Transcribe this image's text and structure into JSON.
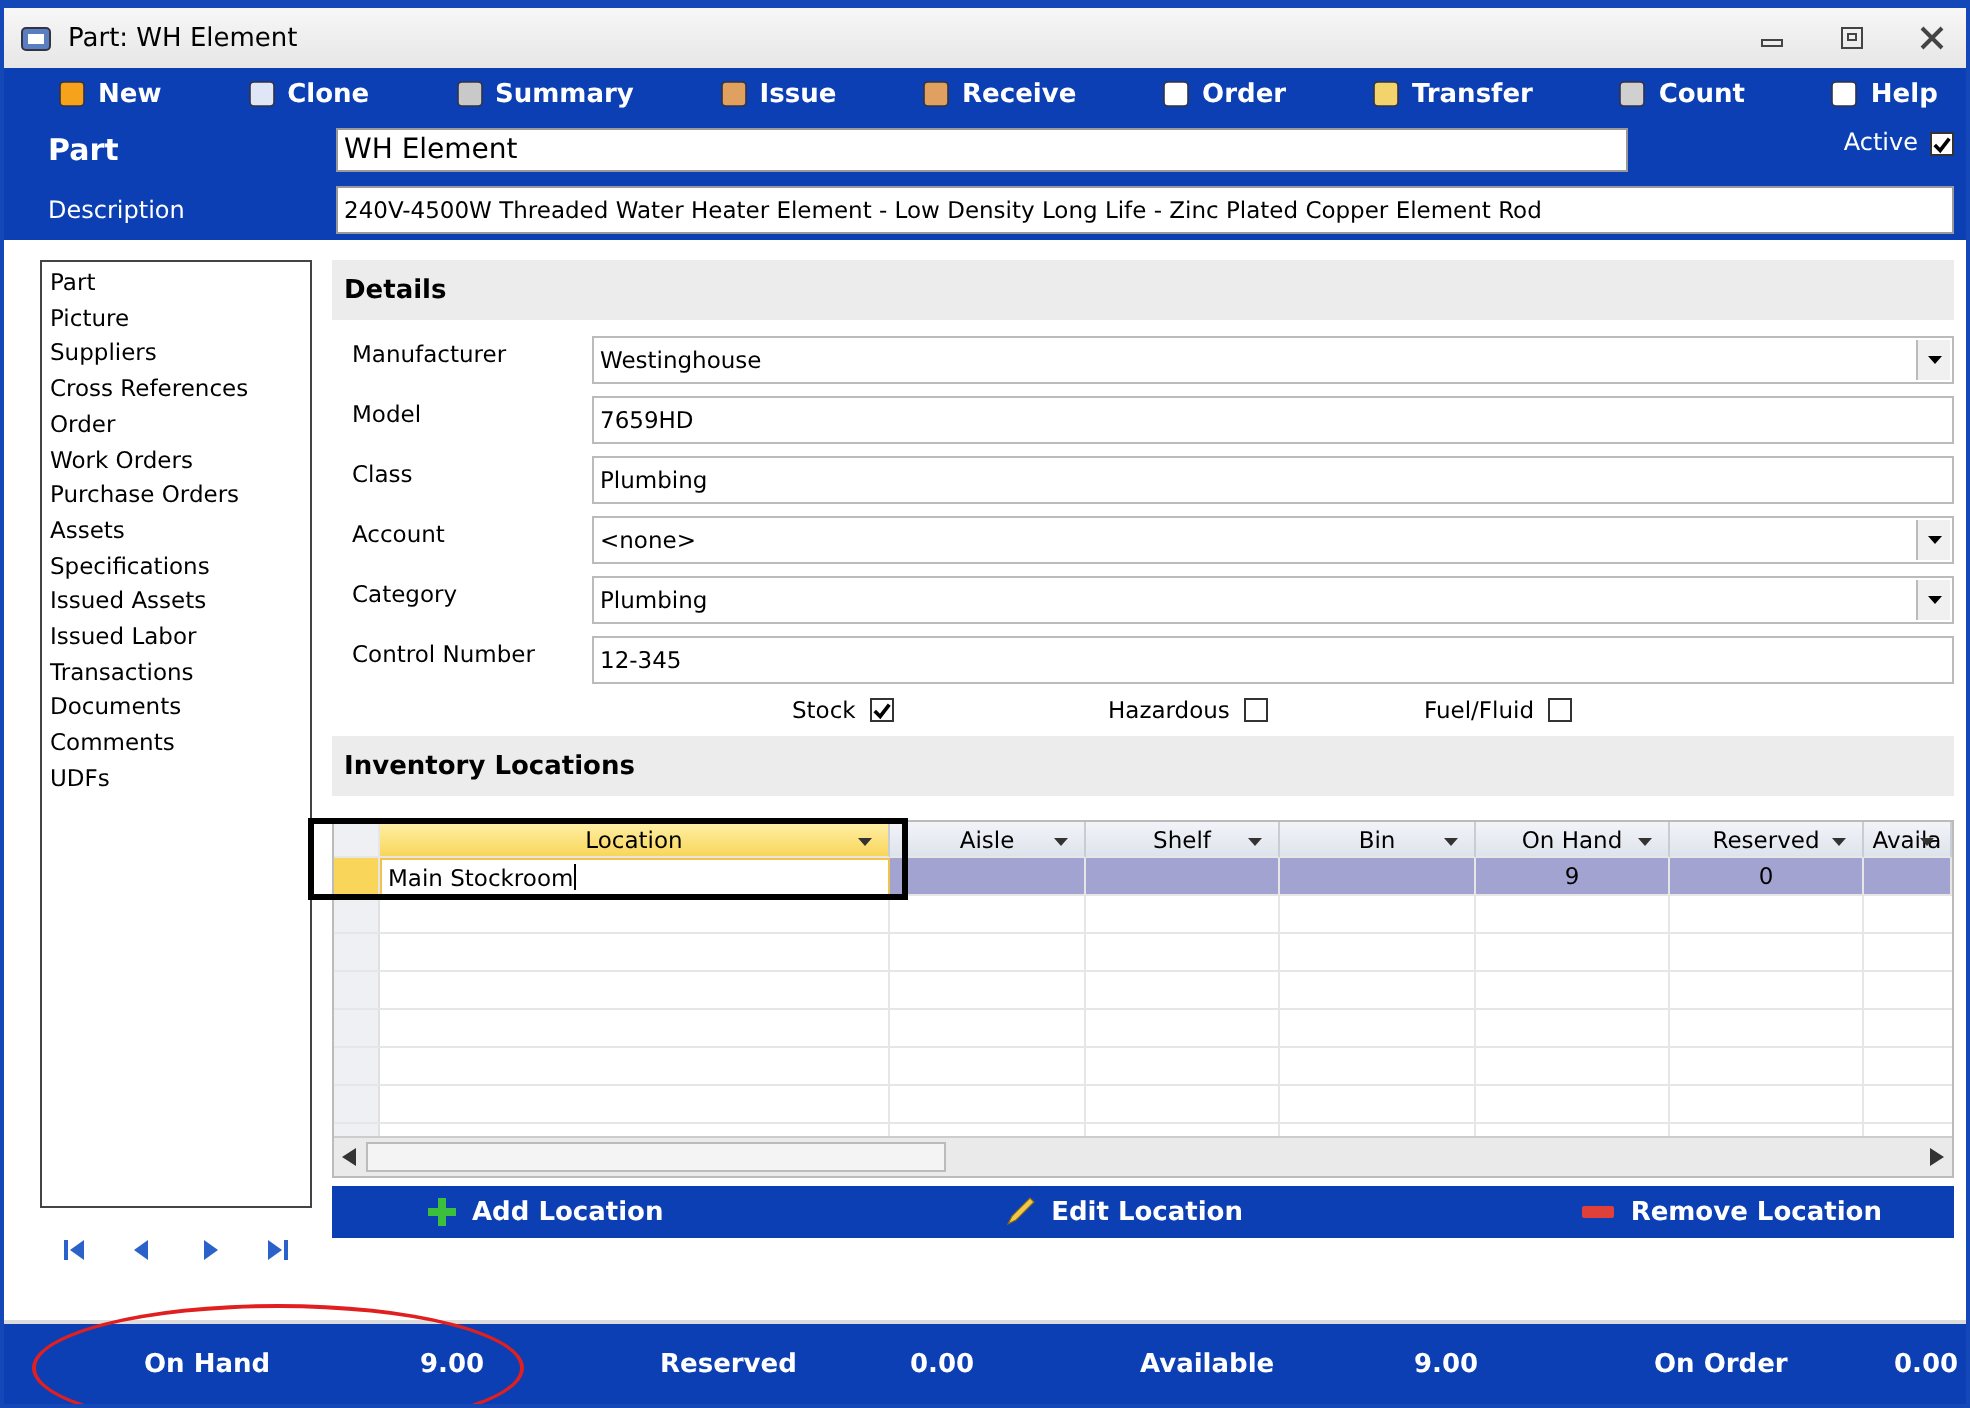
{
  "window": {
    "title": "Part:  WH Element"
  },
  "toolbar": [
    {
      "label": "New"
    },
    {
      "label": "Clone"
    },
    {
      "label": "Summary"
    },
    {
      "label": "Issue"
    },
    {
      "label": "Receive"
    },
    {
      "label": "Order"
    },
    {
      "label": "Transfer"
    },
    {
      "label": "Count"
    },
    {
      "label": "Help"
    }
  ],
  "part": {
    "label": "Part",
    "value": "WH Element",
    "active_label": "Active",
    "active": true
  },
  "description": {
    "label": "Description",
    "value": "240V-4500W Threaded Water Heater Element - Low Density Long Life - Zinc Plated Copper Element Rod"
  },
  "sidebar": {
    "items": [
      "Part",
      "Picture",
      "Suppliers",
      "Cross References",
      "Order",
      "Work Orders",
      "Purchase Orders",
      "Assets",
      "Specifications",
      "Issued Assets",
      "Issued Labor",
      "Transactions",
      "Documents",
      "Comments",
      "UDFs"
    ]
  },
  "details": {
    "title": "Details",
    "fields": [
      {
        "label": "Manufacturer",
        "value": "Westinghouse",
        "kind": "dropdown"
      },
      {
        "label": "Model",
        "value": "7659HD",
        "kind": "text"
      },
      {
        "label": "Class",
        "value": "Plumbing",
        "kind": "text"
      },
      {
        "label": "Account",
        "value": "<none>",
        "kind": "dropdown"
      },
      {
        "label": "Category",
        "value": "Plumbing",
        "kind": "dropdown"
      },
      {
        "label": "Control Number",
        "value": "12-345",
        "kind": "text"
      }
    ],
    "checkboxes": [
      {
        "label": "Stock",
        "checked": true
      },
      {
        "label": "Hazardous",
        "checked": false
      },
      {
        "label": "Fuel/Fluid",
        "checked": false
      }
    ]
  },
  "inventory": {
    "title": "Inventory Locations",
    "columns": [
      "Location",
      "Aisle",
      "Shelf",
      "Bin",
      "On Hand",
      "Reserved",
      "Availa"
    ],
    "rows": [
      {
        "selected": true,
        "cells": [
          "Main Stockroom",
          null,
          null,
          null,
          "9",
          "0",
          null
        ]
      }
    ]
  },
  "actions": [
    {
      "label": "Add Location",
      "kind": "add"
    },
    {
      "label": "Edit Location",
      "kind": "edit"
    },
    {
      "label": "Remove Location",
      "kind": "remove"
    }
  ],
  "footer": [
    {
      "label": "On Hand",
      "value": "9.00"
    },
    {
      "label": "Reserved",
      "value": "0.00"
    },
    {
      "label": "Available",
      "value": "9.00"
    },
    {
      "label": "On Order",
      "value": "0.00"
    }
  ]
}
